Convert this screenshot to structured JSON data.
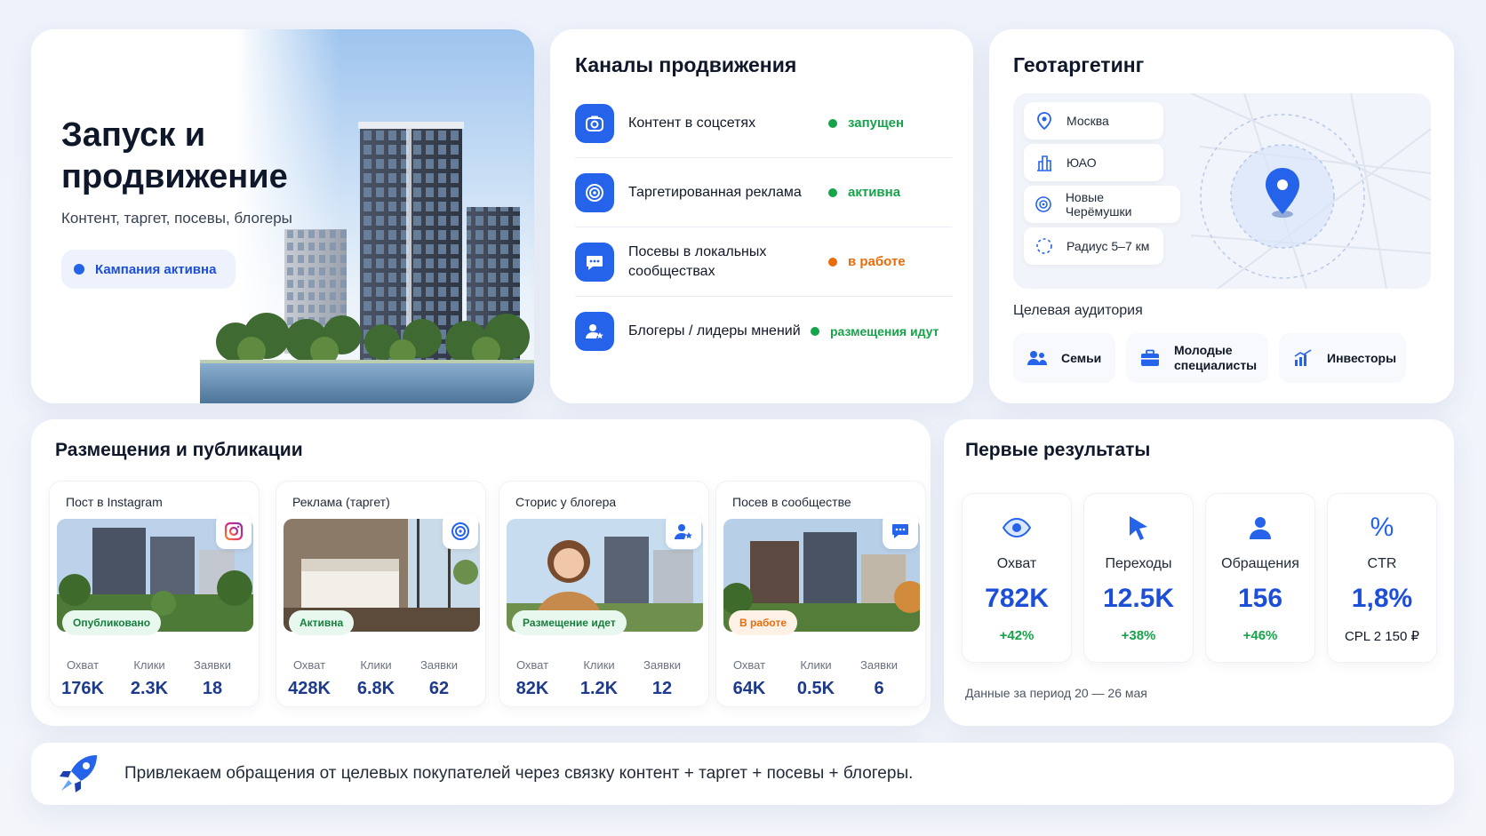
{
  "hero": {
    "title": "Запуск и продвижение",
    "subtitle": "Контент, таргет, посевы, блогеры",
    "badge": "Кампания активна"
  },
  "channels": {
    "title": "Каналы продвижения",
    "items": [
      {
        "label": "Контент в соцсетях",
        "status": "запущен",
        "status_color": "#16a34a",
        "icon": "camera-icon"
      },
      {
        "label": "Таргетированная реклама",
        "status": "активна",
        "status_color": "#16a34a",
        "icon": "target-icon"
      },
      {
        "label": "Посевы в локальных сообществах",
        "status": "в работе",
        "status_color": "#ea6c0a",
        "icon": "chat-icon"
      },
      {
        "label": "Блогеры / лидеры мнений",
        "status": "размещения идут",
        "status_color": "#16a34a",
        "icon": "blogger-icon"
      }
    ]
  },
  "geo": {
    "title": "Геотаргетинг",
    "chips": [
      {
        "label": "Москва",
        "icon": "pin-icon"
      },
      {
        "label": "ЮАО",
        "icon": "building-icon"
      },
      {
        "label": "Новые Черёмушки",
        "icon": "target-icon"
      },
      {
        "label": "Радиус 5–7 км",
        "icon": "radius-icon"
      }
    ],
    "audience_title": "Целевая аудитория",
    "audience": [
      {
        "label": "Семьи",
        "icon": "family-icon"
      },
      {
        "label": "Молодые специалисты",
        "icon": "briefcase-icon"
      },
      {
        "label": "Инвесторы",
        "icon": "growth-chart-icon"
      }
    ]
  },
  "placements": {
    "title": "Размещения и публикации",
    "stat_labels": [
      "Охват",
      "Клики",
      "Заявки"
    ],
    "items": [
      {
        "title": "Пост в Instagram",
        "badge": "Опубликовано",
        "badge_tone": "green",
        "icon": "instagram-icon",
        "reach": "176K",
        "clicks": "2.3K",
        "leads": "18"
      },
      {
        "title": "Реклама (таргет)",
        "badge": "Активна",
        "badge_tone": "green",
        "icon": "target-icon",
        "reach": "428K",
        "clicks": "6.8K",
        "leads": "62"
      },
      {
        "title": "Сторис у блогера",
        "badge": "Размещение идет",
        "badge_tone": "green",
        "icon": "blogger-icon",
        "reach": "82K",
        "clicks": "1.2K",
        "leads": "12"
      },
      {
        "title": "Посев в сообществе",
        "badge": "В работе",
        "badge_tone": "orange",
        "icon": "chat-icon",
        "reach": "64K",
        "clicks": "0.5K",
        "leads": "6"
      }
    ]
  },
  "results": {
    "title": "Первые результаты",
    "items": [
      {
        "label": "Охват",
        "value": "782K",
        "delta": "+42%",
        "icon": "eye-icon"
      },
      {
        "label": "Переходы",
        "value": "12.5K",
        "delta": "+38%",
        "icon": "cursor-icon"
      },
      {
        "label": "Обращения",
        "value": "156",
        "delta": "+46%",
        "icon": "user-icon"
      },
      {
        "label": "CTR",
        "value": "1,8%",
        "delta": "CPL  2 150 ₽",
        "icon": "percent-icon"
      }
    ],
    "note": "Данные за период 20 — 26 мая"
  },
  "footer": {
    "text": "Привлекаем обращения от целевых покупателей через связку контент + таргет + посевы + блогеры.",
    "icon": "rocket-icon"
  },
  "colors": {
    "accent": "#2563eb",
    "value_blue": "#1d4ed8",
    "green": "#16a34a",
    "orange": "#ea6c0a"
  }
}
